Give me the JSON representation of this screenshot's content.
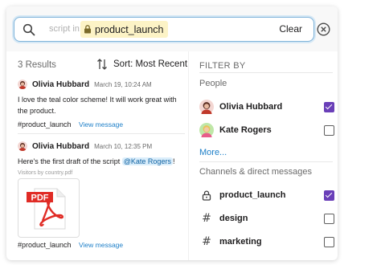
{
  "search": {
    "prefix": "script in:",
    "token": "product_launch",
    "clear_label": "Clear"
  },
  "results": {
    "count_label": "3 Results",
    "sort_label": "Sort: Most Recent"
  },
  "messages": [
    {
      "author": "Olivia Hubbard",
      "time": "March 19, 10:24 AM",
      "text": "I love the teal color scheme! It will work great with the product.",
      "channel": "#product_launch",
      "view_label": "View message"
    },
    {
      "author": "Olivia Hubbard",
      "time": "March 10, 12:35 PM",
      "text_before": "Here's the first draft of the script",
      "mention": "@Kate Rogers",
      "text_after": "!",
      "file_caption": "Visitors by country.pdf",
      "file_type": "PDF",
      "channel": "#product_launch",
      "view_label": "View message"
    }
  ],
  "filter": {
    "title": "FILTER BY",
    "people_label": "People",
    "people": [
      {
        "name": "Olivia Hubbard",
        "checked": true
      },
      {
        "name": "Kate Rogers",
        "checked": false
      }
    ],
    "more_label": "More...",
    "channels_label": "Channels & direct messages",
    "channels": [
      {
        "name": "product_launch",
        "icon": "lock-icon",
        "checked": true
      },
      {
        "name": "design",
        "icon": "hash-icon",
        "checked": false
      },
      {
        "name": "marketing",
        "icon": "hash-icon",
        "checked": false
      }
    ]
  },
  "colors": {
    "accent": "#6a3fb8",
    "link": "#1d7fc8",
    "token_bg": "#fcf3c6",
    "mention_bg": "#dbeefb"
  }
}
